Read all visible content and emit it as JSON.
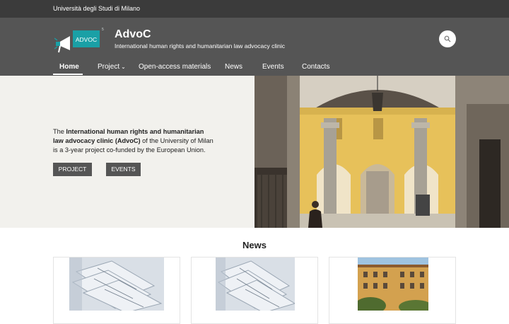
{
  "topbar": {
    "university": "Università degli Studi di Milano"
  },
  "brand": {
    "logo_text": "ADVOC",
    "title": "AdvoC",
    "subtitle": "International human rights and humanitarian law advocacy clinic"
  },
  "nav": {
    "items": [
      {
        "label": "Home"
      },
      {
        "label": "Project"
      },
      {
        "label": "Open-access materials"
      },
      {
        "label": "News"
      },
      {
        "label": "Events"
      },
      {
        "label": "Contacts"
      }
    ],
    "active": "Home"
  },
  "hero": {
    "text_prefix": "The ",
    "text_bold": "International human rights and humanitarian law advocacy clinic (AdvoC)",
    "text_suffix": " of the University of Milan is a 3-year project co-funded by the European Union.",
    "buttons": {
      "project": "PROJECT",
      "events": "EVENTS"
    }
  },
  "news": {
    "title": "News"
  },
  "colors": {
    "topbar_bg": "#3b3b3b",
    "header_bg": "#555555",
    "hero_bg": "#f2f1ed",
    "logo_teal": "#1aa0a6"
  },
  "icons": [
    "search-icon",
    "chevron-down-icon",
    "megaphone-icon"
  ]
}
